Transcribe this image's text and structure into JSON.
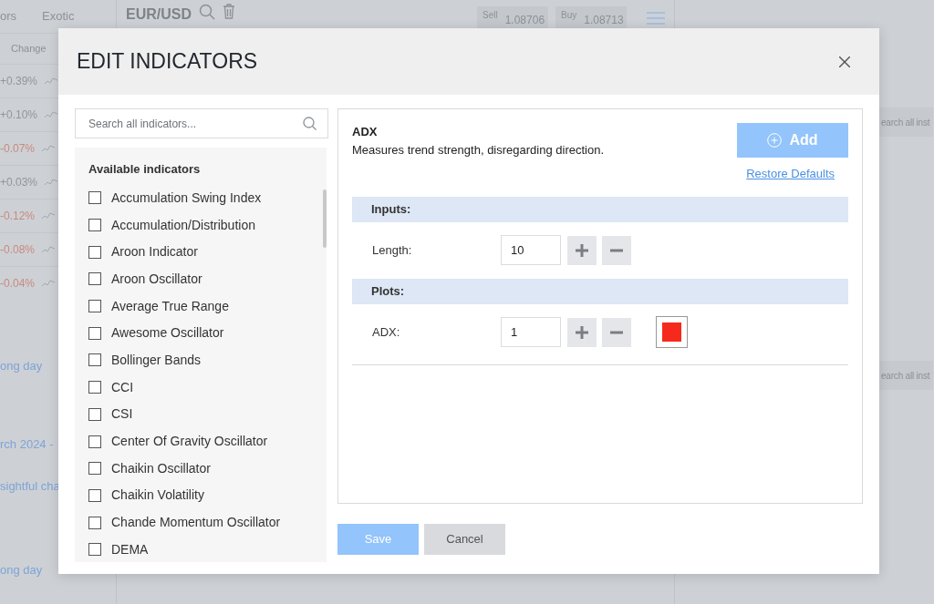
{
  "background": {
    "tabs": [
      {
        "label": "ors"
      },
      {
        "label": "Exotic"
      }
    ],
    "change_header": "Change",
    "changes": [
      {
        "value": "+0.39%",
        "kind": "gain"
      },
      {
        "value": "+0.10%",
        "kind": "gain"
      },
      {
        "value": "-0.07%",
        "kind": "loss"
      },
      {
        "value": "+0.03%",
        "kind": "gain"
      },
      {
        "value": "-0.12%",
        "kind": "loss"
      },
      {
        "value": "-0.08%",
        "kind": "loss"
      },
      {
        "value": "-0.04%",
        "kind": "loss"
      }
    ],
    "links": [
      "ong day",
      "rch 2024 -",
      "sightful cha",
      "ong day"
    ],
    "instrument": {
      "symbol": "EUR/USD",
      "sell_label": "Sell",
      "sell": "1.08706",
      "buy_label": "Buy",
      "buy": "1.08713"
    },
    "search_placeholders": [
      "earch all inst",
      "earch all inst"
    ]
  },
  "dialog": {
    "title": "EDIT INDICATORS",
    "search": {
      "placeholder": "Search all indicators..."
    },
    "list_heading": "Available indicators",
    "indicators": [
      {
        "name": "Accumulation Swing Index",
        "checked": false
      },
      {
        "name": "Accumulation/Distribution",
        "checked": false
      },
      {
        "name": "Aroon Indicator",
        "checked": false
      },
      {
        "name": "Aroon Oscillator",
        "checked": false
      },
      {
        "name": "Average True Range",
        "checked": false
      },
      {
        "name": "Awesome Oscillator",
        "checked": false
      },
      {
        "name": "Bollinger Bands",
        "checked": false
      },
      {
        "name": "CCI",
        "checked": false
      },
      {
        "name": "CSI",
        "checked": false
      },
      {
        "name": "Center Of Gravity Oscillator",
        "checked": false
      },
      {
        "name": "Chaikin Oscillator",
        "checked": false
      },
      {
        "name": "Chaikin Volatility",
        "checked": false
      },
      {
        "name": "Chande Momentum Oscillator",
        "checked": false
      },
      {
        "name": "DEMA",
        "checked": false
      }
    ],
    "detail": {
      "name": "ADX",
      "description": "Measures trend strength, disregarding direction.",
      "add_button": "Add",
      "restore_link": "Restore Defaults",
      "sections": [
        {
          "heading": "Inputs:",
          "rows": [
            {
              "label": "Length:",
              "value": "10"
            }
          ]
        },
        {
          "heading": "Plots:",
          "rows": [
            {
              "label": "ADX:",
              "value": "1",
              "color": "#f52a1c"
            }
          ]
        }
      ]
    },
    "buttons": [
      {
        "label": "Save",
        "kind": "primary"
      },
      {
        "label": "Cancel",
        "kind": "secondary"
      }
    ]
  }
}
